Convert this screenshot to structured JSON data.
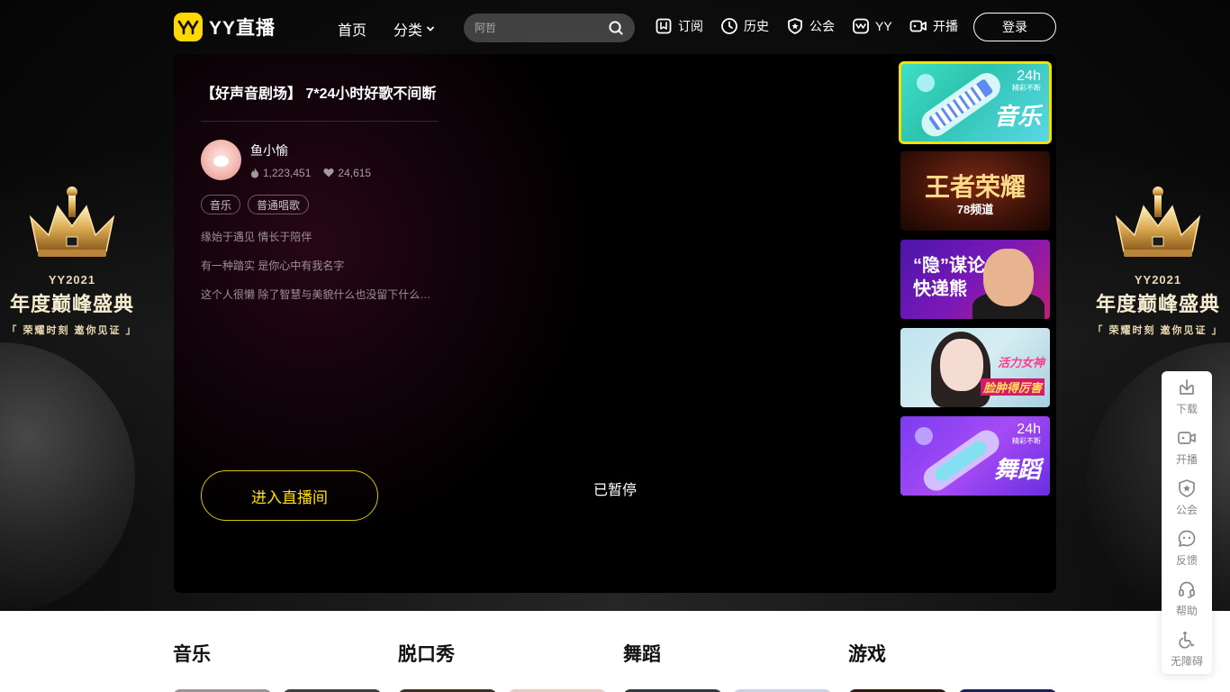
{
  "brand": {
    "logo_text": "YY直播",
    "accent": "#ffd800"
  },
  "nav": {
    "home": "首页",
    "category": "分类",
    "search_placeholder": "阿哲",
    "items": [
      {
        "label": "订阅",
        "icon": "bookmark-icon"
      },
      {
        "label": "历史",
        "icon": "clock-icon"
      },
      {
        "label": "公会",
        "icon": "shield-icon"
      },
      {
        "label": "YY",
        "icon": "yy-icon"
      },
      {
        "label": "开播",
        "icon": "camera-icon"
      }
    ],
    "login": "登录"
  },
  "banner": {
    "year_line": "YY2021",
    "title": "年度巅峰盛典",
    "tagline": "「 荣耀时刻  邀你见证 」"
  },
  "room": {
    "title": "【好声音剧场】 7*24小时好歌不间断",
    "anchor_name": "鱼小愉",
    "viewers": "1,223,451",
    "likes": "24,615",
    "tags": [
      "音乐",
      "普通唱歌"
    ],
    "description": [
      "缘始于遇见 情长于陪伴",
      "有一种踏实 是你心中有我名字",
      "这个人很懒 除了智慧与美貌什么也没留下什么也没留下"
    ],
    "enter_button": "进入直播间",
    "status": "已暂停"
  },
  "thumbnails": [
    {
      "label": "音乐",
      "badge": "24h",
      "badge_sub": "精彩不断",
      "active": true
    },
    {
      "label": "王者荣耀",
      "sub": "78频道",
      "active": false
    },
    {
      "label": "“隐”谋论 快递熊",
      "active": false
    },
    {
      "label_1": "活力女神",
      "label_2": "脸肿得厉害",
      "active": false
    },
    {
      "label": "舞蹈",
      "badge": "24h",
      "badge_sub": "精彩不断",
      "active": false
    }
  ],
  "sections": [
    {
      "title": "音乐"
    },
    {
      "title": "脱口秀"
    },
    {
      "title": "舞蹈"
    },
    {
      "title": "游戏"
    }
  ],
  "sidebar_tools": [
    {
      "label": "下载",
      "icon": "download-icon"
    },
    {
      "label": "开播",
      "icon": "camera-icon"
    },
    {
      "label": "公会",
      "icon": "shield-icon"
    },
    {
      "label": "反馈",
      "icon": "feedback-icon"
    },
    {
      "label": "帮助",
      "icon": "headset-icon"
    },
    {
      "label": "无障碍",
      "icon": "accessibility-icon"
    }
  ]
}
